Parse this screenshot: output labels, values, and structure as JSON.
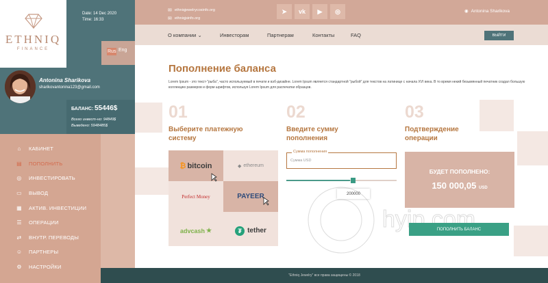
{
  "brand": {
    "name": "ETHNIQ",
    "tagline": "FINANCE"
  },
  "datetime": {
    "date": "Date: 14 Dec 2020",
    "time": "Time: 16:33"
  },
  "lang": {
    "ru": "Rus",
    "en": "Eng"
  },
  "user": {
    "name": "Antonina Sharikova",
    "email": "sharikovantonina123@gmail.com"
  },
  "balance": {
    "label": "БАЛАНС:",
    "value": "55446$",
    "invested": "Всего инвест-но: 94849$",
    "withdrawn": "Выведено: 5948485$"
  },
  "sidebar": {
    "items": [
      {
        "label": "КАБИНЕТ",
        "icon": "cabinet-icon",
        "glyph": "⌂"
      },
      {
        "label": "ПОПОЛНИТЬ",
        "icon": "wallet-icon",
        "glyph": "▤"
      },
      {
        "label": "ИНВЕСТИРОВАТЬ",
        "icon": "invest-icon",
        "glyph": "◎"
      },
      {
        "label": "ВЫВОД",
        "icon": "withdraw-icon",
        "glyph": "▭"
      },
      {
        "label": "АКТИВ. ИНВЕСТИЦИИ",
        "icon": "chart-icon",
        "glyph": "▦"
      },
      {
        "label": "ОПЕРАЦИИ",
        "icon": "operations-icon",
        "glyph": "☰"
      },
      {
        "label": "ВНУТР. ПЕРЕВОДЫ",
        "icon": "transfer-icon",
        "glyph": "⇄"
      },
      {
        "label": "ПАРТНЕРЫ",
        "icon": "partners-icon",
        "glyph": "☺"
      },
      {
        "label": "НАСТРОЙКИ",
        "icon": "settings-icon",
        "glyph": "⚙"
      }
    ],
    "active": "ПОПОЛНИТЬ"
  },
  "header": {
    "email": "ethniqjewelrycosinfo.org",
    "site": "ethniqjsinfo.org",
    "user": "Antonina Sharikova",
    "social": [
      "telegram",
      "vk",
      "youtube",
      "instagram"
    ]
  },
  "nav": {
    "items": [
      "О компании",
      "Инвесторам",
      "Партнерам",
      "Контакты",
      "FAQ"
    ],
    "logout": "ВЫЙТИ"
  },
  "main": {
    "title": "Пополнение баланса",
    "intro": "Lorem Ipsum - это текст-\"рыба\", часто используемый в печати и вэб-дизайне. Lorem Ipsum является стандартной \"рыбой\" для текстов на латинице с начала XVI века. В то время некий безымянный печатник создал большую коллекцию размеров и форм шрифтов, используя Lorem Ipsum для распечатки образцов.",
    "steps": [
      {
        "num": "01",
        "title": "Выберите платежную систему"
      },
      {
        "num": "02",
        "title": "Введите сумму пополнения"
      },
      {
        "num": "03",
        "title": "Подтверждение операции"
      }
    ]
  },
  "payment": {
    "selected": "bitcoin",
    "methods": {
      "bitcoin": "bitcoin",
      "ethereum": "ethereum",
      "pm": "Perfect Money",
      "payeer": "PAYEER",
      "advcash": "advcash",
      "tether": "tether"
    }
  },
  "amount": {
    "label": "Сумма пополнения",
    "placeholder": "Сумма USD",
    "slider_value": "200000",
    "slider_fraction": 0.58
  },
  "confirm": {
    "label": "БУДЕТ ПОПОЛНЕНО:",
    "value": "150 000,05",
    "currency": "USD",
    "button": "ПОПОЛНИТЬ БАЛАНС"
  },
  "watermark": "hyip.com",
  "footer": "\"Ethniq Jewelry\" все права защищены © 2018",
  "colors": {
    "teal": "#4f7379",
    "rose": "#d4a692",
    "accent": "#b5763f",
    "green": "#3aa085"
  }
}
